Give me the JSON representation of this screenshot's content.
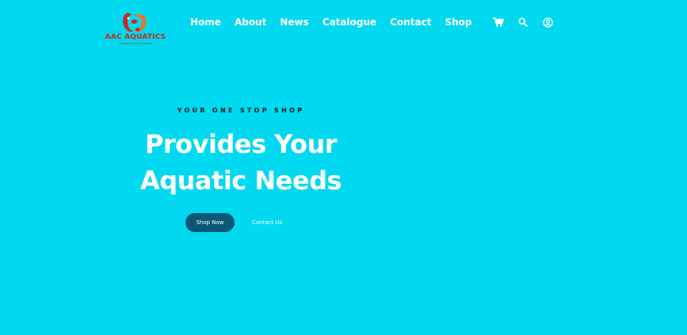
{
  "brand": {
    "name": "AAC AQUATICS",
    "tagline": "AQUARIUM & FISH SUPPLIES",
    "colors": {
      "primary": "#c62b1c",
      "secondary": "#e8752a"
    }
  },
  "nav": {
    "items": [
      {
        "label": "Home"
      },
      {
        "label": "About"
      },
      {
        "label": "News"
      },
      {
        "label": "Catalogue"
      },
      {
        "label": "Contact"
      },
      {
        "label": "Shop"
      }
    ],
    "icons": [
      "cart-icon",
      "search-icon",
      "user-account-icon"
    ]
  },
  "hero": {
    "eyebrow": "YOUR ONE STOP SHOP",
    "headline_line1": "Provides Your",
    "headline_line2": "Aquatic Needs",
    "primary_button": "Shop Now",
    "secondary_button": "Contact Us"
  },
  "theme": {
    "background": "#00d9ef",
    "button": "#0a5878",
    "text": "#ffffff",
    "eyebrow": "#101a2a"
  }
}
